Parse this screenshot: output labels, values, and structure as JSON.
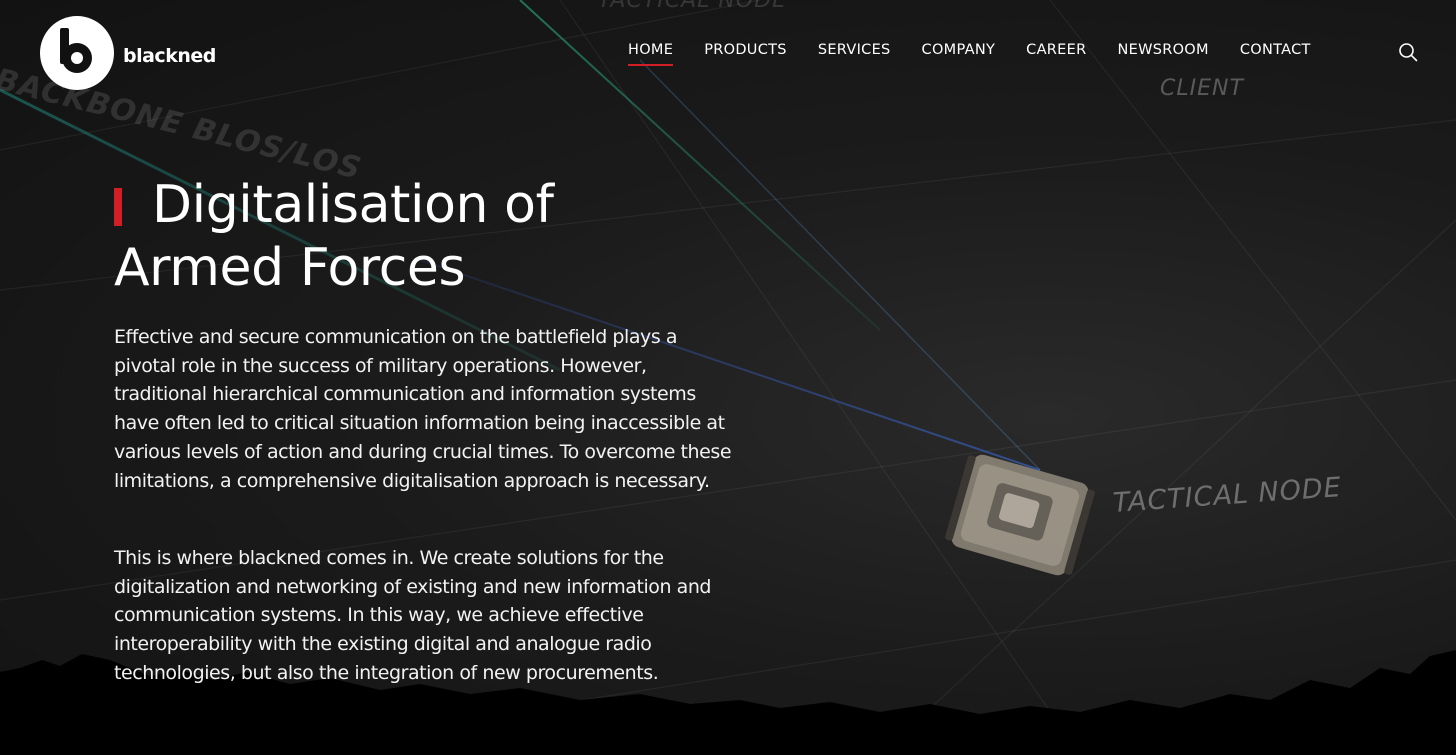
{
  "brand": {
    "name": "blackned",
    "logo_icon": "blackned-b-logo"
  },
  "nav": {
    "items": [
      {
        "label": "HOME",
        "active": true
      },
      {
        "label": "PRODUCTS",
        "active": false
      },
      {
        "label": "SERVICES",
        "active": false
      },
      {
        "label": "COMPANY",
        "active": false
      },
      {
        "label": "CAREER",
        "active": false
      },
      {
        "label": "NEWSROOM",
        "active": false
      },
      {
        "label": "CONTACT",
        "active": false
      }
    ],
    "search_icon": "search-icon",
    "active_color": "#d21f26"
  },
  "background_labels": {
    "backbone": "BACKBONE BLOS/LOS",
    "top": "TACTICAL NODE",
    "client": "CLIENT",
    "tactical": "TACTICAL NODE"
  },
  "hero": {
    "title": "Digitalisation of Armed Forces",
    "accent_color": "#d21f26",
    "paragraphs": [
      "Effective and secure communication on the battlefield plays a pivotal role in the success of military operations. However, traditional hierarchical communication and information systems have often led to critical situation information being inaccessible at various levels of action and during crucial times. To overcome these limitations, a comprehensive digitalisation approach is necessary.",
      "This is where blackned comes in. We create solutions for the digitalization and networking of existing and new information and communication systems. In this way, we achieve effective interoperability with the existing digital and analogue radio technologies, but also the integration of new procurements."
    ]
  }
}
